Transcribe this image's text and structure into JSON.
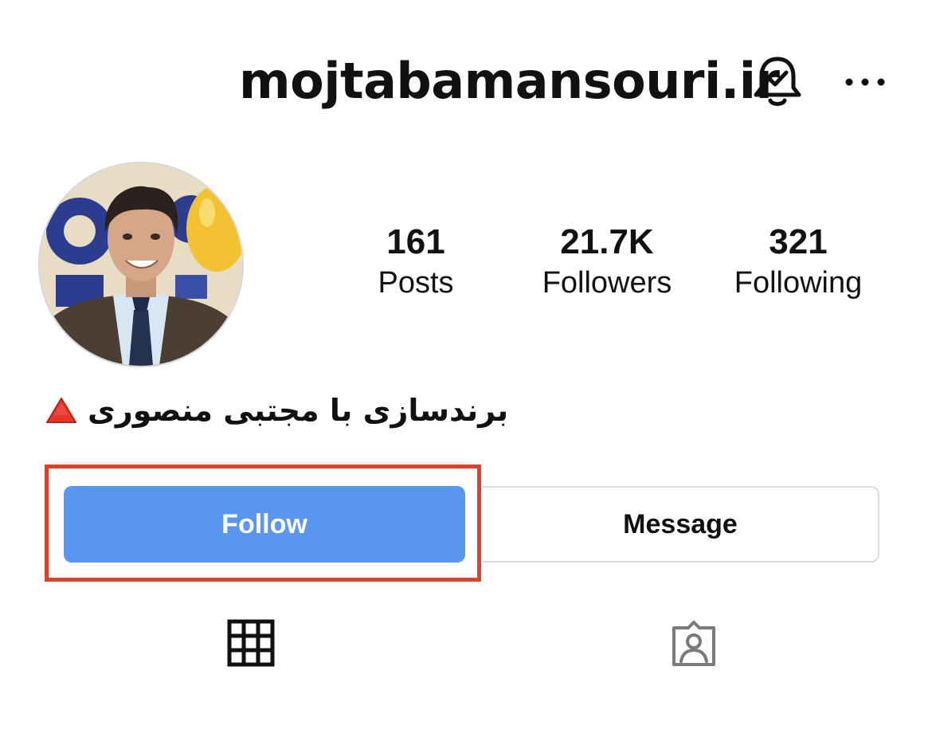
{
  "header": {
    "username": "mojtabamansouri.ir",
    "bell_icon": "bell-check-icon",
    "more_icon": "more-horizontal-icon"
  },
  "avatar": {
    "icon": "profile-photo"
  },
  "stats": [
    {
      "value": "161",
      "label": "Posts"
    },
    {
      "value": "21.7K",
      "label": "Followers"
    },
    {
      "value": "321",
      "label": "Following"
    }
  ],
  "bio": {
    "text": "برندسازی با مجتبی منصوری",
    "emoji_icon": "red-triangle-icon"
  },
  "actions": {
    "follow_label": "Follow",
    "message_label": "Message"
  },
  "tabs": [
    {
      "icon": "grid-icon"
    },
    {
      "icon": "tagged-person-icon"
    }
  ],
  "colors": {
    "follow_button": "#5996ee",
    "highlight_box": "#d9432b",
    "text": "#111111"
  }
}
